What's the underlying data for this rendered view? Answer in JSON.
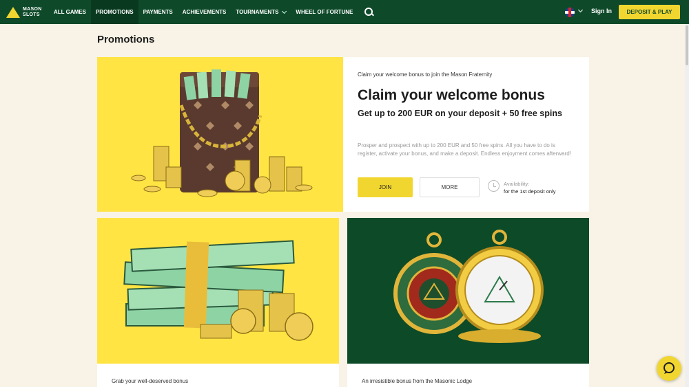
{
  "brand": {
    "logo_line1": "MASON",
    "logo_line2": "SLOTS"
  },
  "nav": {
    "items": [
      {
        "label": "ALL GAMES"
      },
      {
        "label": "PROMOTIONS",
        "active": true
      },
      {
        "label": "PAYMENTS"
      },
      {
        "label": "ACHIEVEMENTS"
      },
      {
        "label": "TOURNAMENTS",
        "dropdown": true
      },
      {
        "label": "WHEEL OF FORTUNE"
      }
    ],
    "sign_in": "Sign In",
    "deposit": "DEPOSIT & PLAY",
    "language_icon": "uk-flag-icon"
  },
  "page": {
    "title": "Promotions"
  },
  "featured": {
    "pre": "Claim your welcome bonus to join the Mason Fraternity",
    "headline": "Claim your welcome bonus",
    "subhead": "Get up to 200 EUR on your deposit + 50 free spins",
    "description": "Prosper and prospect with up to 200 EUR and 50 free spins. All you have to do is register, activate your bonus, and make a deposit. Endless enjoyment comes afterward!",
    "join": "JOIN",
    "more": "MORE",
    "availability_label": "Availability:",
    "availability_value": "for the 1st deposit only"
  },
  "cards": [
    {
      "caption": "Grab your well-deserved bonus"
    },
    {
      "caption": "An irresistible bonus from the Masonic Lodge"
    }
  ],
  "colors": {
    "nav_bg": "#0e4a2a",
    "accent_yellow": "#f2d630",
    "image_yellow": "#ffe443",
    "image_green": "#0d4a28",
    "page_bg": "#f8f3e6"
  }
}
